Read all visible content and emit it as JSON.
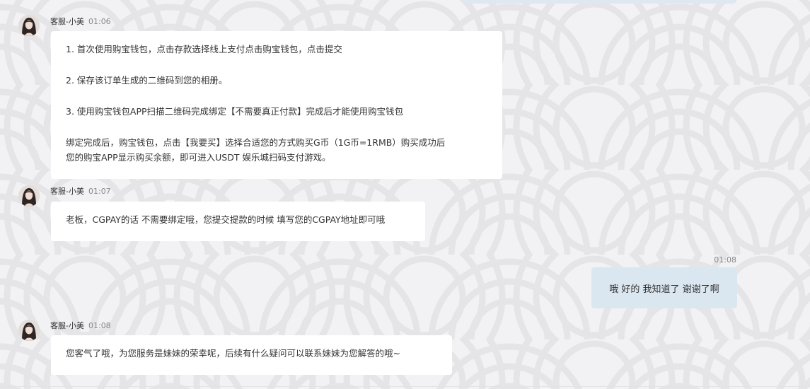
{
  "colors": {
    "page_background": "#f1f1f3",
    "agent_bubble": "#ffffff",
    "self_bubble": "#dbe7f0",
    "text": "#333333",
    "time_text": "#888888"
  },
  "messages": [
    {
      "sender": "客服-小美",
      "time": "01:06",
      "lines": [
        "1. 首次使用购宝钱包，点击存款选择线上支付点击购宝钱包，点击提交",
        "2. 保存该订单生成的二维码到您的相册。",
        "3. 使用购宝钱包APP扫描二维码完成绑定【不需要真正付款】完成后才能使用购宝钱包",
        "绑定完成后，购宝钱包，点击【我要买】选择合适您的方式购买G币（1G币=1RMB）购买成功后",
        "您的购宝APP显示购买余额，即可进入USDT 娱乐城扫码支付游戏。"
      ]
    },
    {
      "sender": "客服-小美",
      "time": "01:07",
      "lines": [
        "老板，CGPAY的话 不需要绑定哦，您提交提款的时候 填写您的CGPAY地址即可哦"
      ]
    },
    {
      "sender": "",
      "time": "01:08",
      "self": true,
      "lines": [
        "哦 好的 我知道了 谢谢了啊"
      ]
    },
    {
      "sender": "客服-小美",
      "time": "01:08",
      "lines": [
        "您客气了哦，为您服务是妹妹的荣幸呢，后续有什么疑问可以联系妹妹为您解答的哦~"
      ]
    }
  ]
}
